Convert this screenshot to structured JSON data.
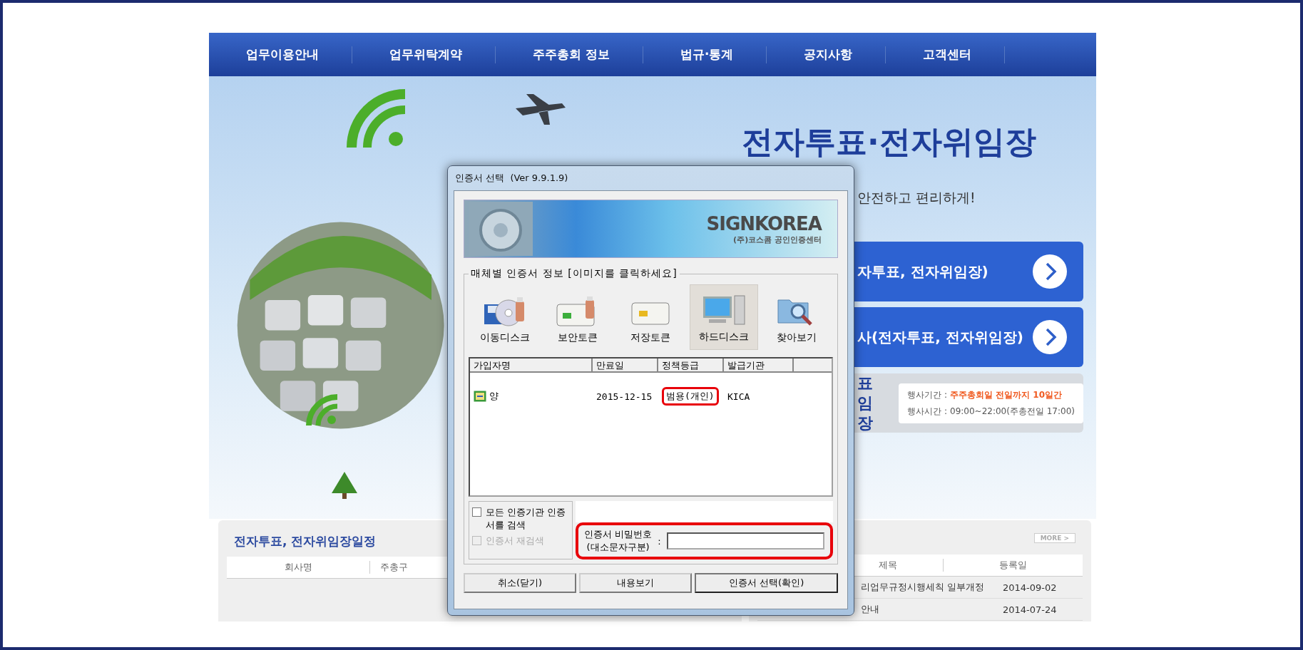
{
  "nav": {
    "items": [
      "업무이용안내",
      "업무위탁계약",
      "주주총회 정보",
      "법규·통계",
      "공지사항",
      "고객센터"
    ]
  },
  "hero": {
    "title": "전자투표·전자위임장",
    "subtitle": "안전하고 편리하게!",
    "links": [
      {
        "label": "자투표, 전자위임장)"
      },
      {
        "label": "사(전자투표, 전자위임장)"
      }
    ],
    "info": {
      "title_lines": [
        "표",
        "임장"
      ],
      "lines": [
        {
          "label": "행사기간 :",
          "value": "주주총회일 전일까지 10일간",
          "highlight": true
        },
        {
          "label": "행사시간 :",
          "value": "09:00~22:00(주총전일 17:00)",
          "highlight": false
        }
      ]
    }
  },
  "schedule": {
    "title": "전자투표, 전자위임장일정",
    "columns": [
      "회사명",
      "주총구"
    ]
  },
  "notices": {
    "more": "MORE >",
    "columns": [
      "제목",
      "등록일"
    ],
    "rows": [
      {
        "title": "리업무규정시행세칙 일부개정",
        "date": "2014-09-02"
      },
      {
        "title": "안내",
        "date": "2014-07-24"
      }
    ]
  },
  "dialog": {
    "title": "인증서 선택  (Ver 9.9.1.9)",
    "banner": {
      "logo": "SIGNKOREA",
      "caption": "(주)코스콤 공인인증센터"
    },
    "group_label": "매체별 인증서 정보 [이미지를 클릭하세요]",
    "media": [
      {
        "kind": "removable",
        "label": "이동디스크",
        "selected": false
      },
      {
        "kind": "token",
        "label": "보안토큰",
        "selected": false
      },
      {
        "kind": "smartcard",
        "label": "저장토큰",
        "selected": false
      },
      {
        "kind": "harddisk",
        "label": "하드디스크",
        "selected": true
      },
      {
        "kind": "browse",
        "label": "찾아보기",
        "selected": false
      }
    ],
    "list": {
      "columns": [
        "가입자명",
        "만료일",
        "정책등급",
        "발급기관"
      ],
      "rows": [
        {
          "name": "양",
          "expires": "2015-12-15",
          "policy": "범용(개인)",
          "issuer": "KICA",
          "policy_highlighted": true,
          "selected": false
        }
      ]
    },
    "options": [
      {
        "label": "모든 인증기관 인증서를 검색",
        "checked": false,
        "disabled": false
      },
      {
        "label": "인증서 재검색",
        "checked": false,
        "disabled": true
      }
    ],
    "password": {
      "label_lines": [
        "인증서 비밀번호",
        "(대소문자구분)"
      ],
      "separator": ":",
      "highlighted": true
    },
    "buttons": [
      {
        "label": "취소(닫기)",
        "default": false
      },
      {
        "label": "내용보기",
        "default": false
      },
      {
        "label": "인증서 선택(확인)",
        "default": true
      }
    ]
  }
}
